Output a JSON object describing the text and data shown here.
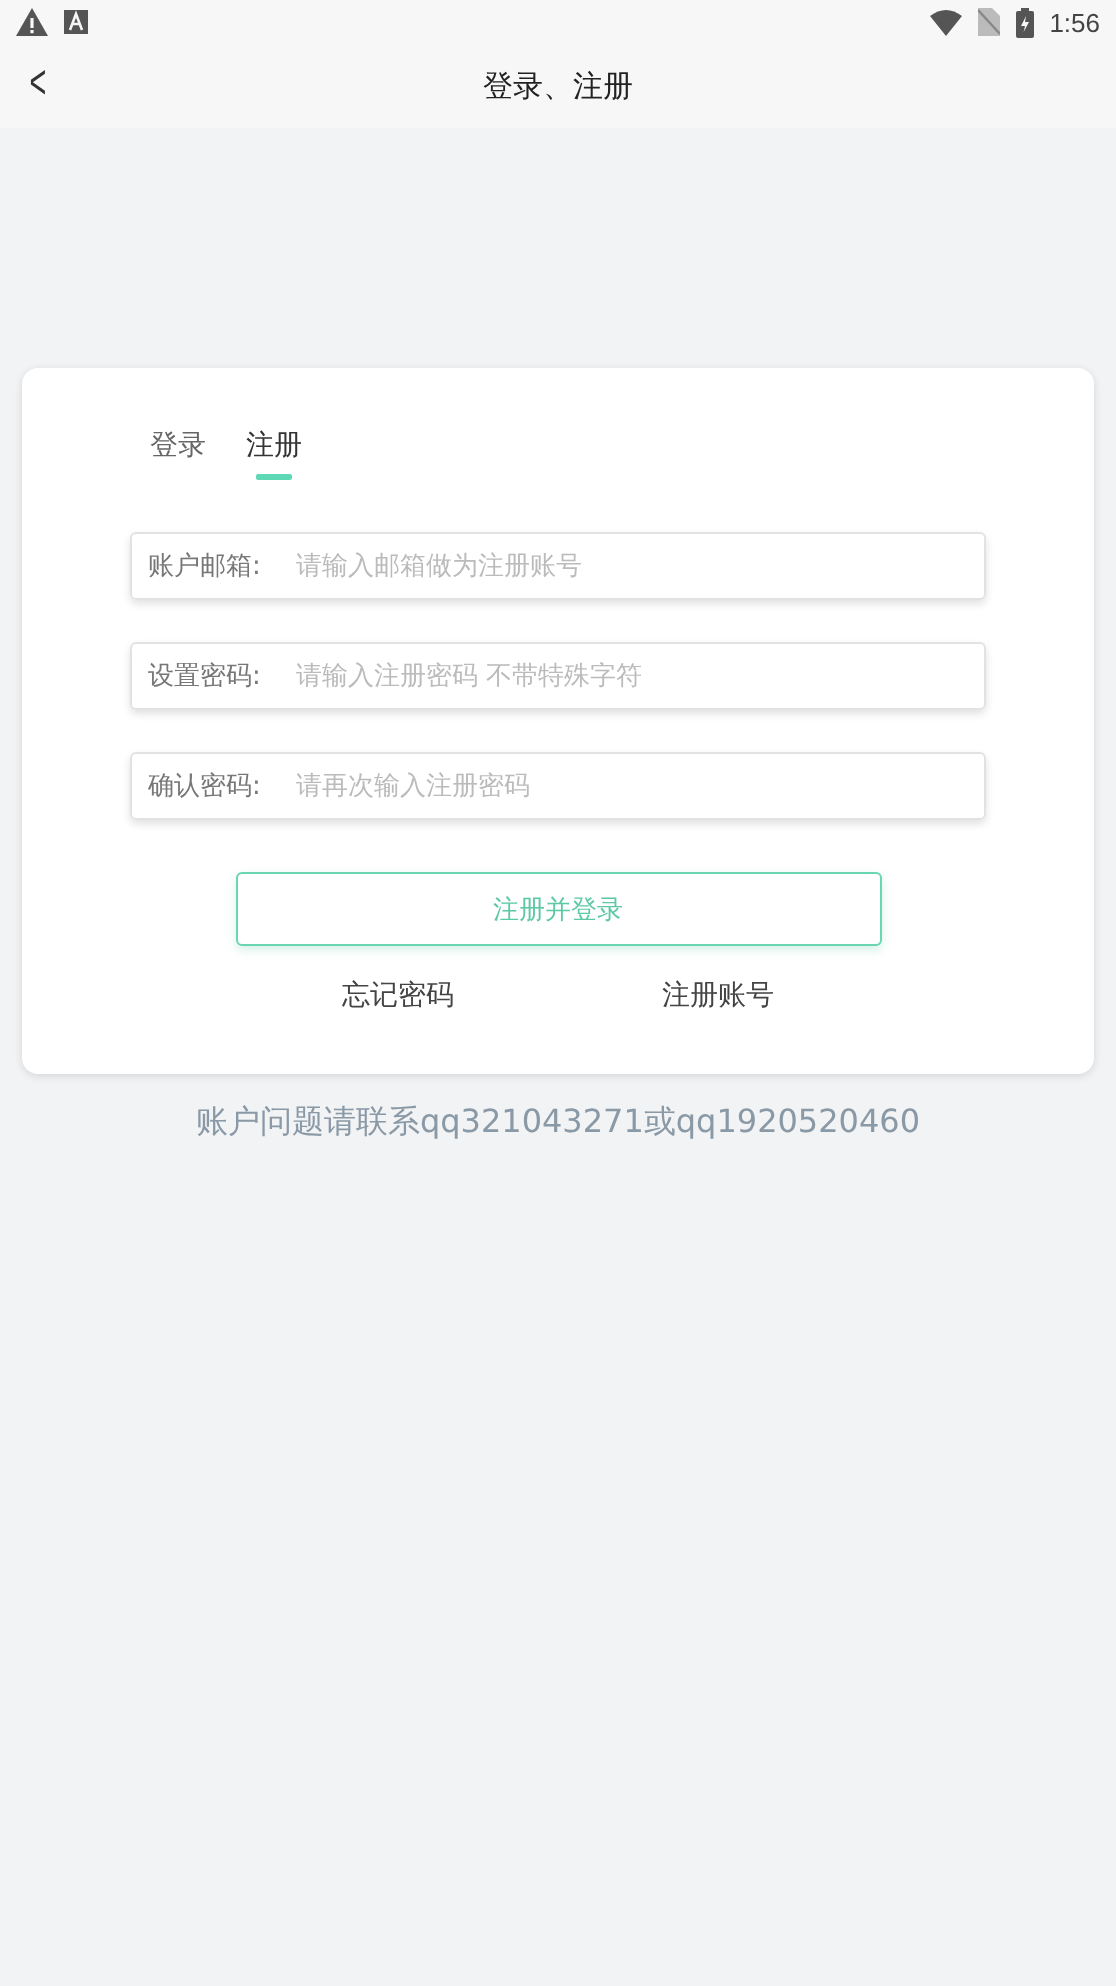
{
  "status_bar": {
    "time": "1:56"
  },
  "header": {
    "back": "<",
    "title": "登录、注册"
  },
  "tabs": [
    {
      "label": "登录",
      "selected": false
    },
    {
      "label": "注册",
      "selected": true
    }
  ],
  "fields": [
    {
      "label": "账户邮箱:",
      "placeholder": "请输入邮箱做为注册账号"
    },
    {
      "label": "设置密码:",
      "placeholder": "请输入注册密码 不带特殊字符"
    },
    {
      "label": "确认密码:",
      "placeholder": "请再次输入注册密码"
    }
  ],
  "submit": "注册并登录",
  "links": [
    "忘记密码",
    "注册账号"
  ],
  "contact": "账户问题请联系qq321043271或qq1920520460"
}
